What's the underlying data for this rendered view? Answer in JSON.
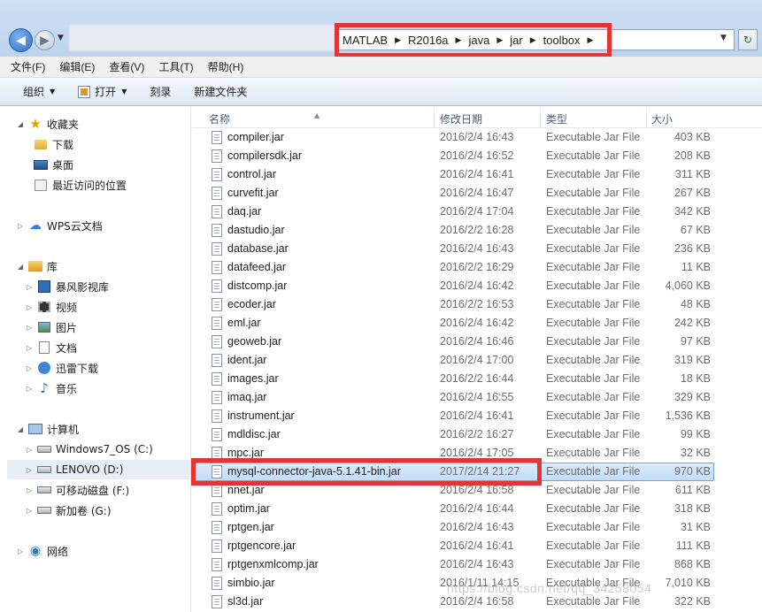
{
  "address": {
    "crumbs": [
      "MATLAB",
      "R2016a",
      "java",
      "jar",
      "toolbox"
    ]
  },
  "menu": [
    "文件(F)",
    "编辑(E)",
    "查看(V)",
    "工具(T)",
    "帮助(H)"
  ],
  "toolbar": {
    "organize": "组织",
    "open": "打开",
    "burn": "刻录",
    "new_folder": "新建文件夹"
  },
  "nav": {
    "favorites": "收藏夹",
    "downloads": "下载",
    "desktop": "桌面",
    "recent": "最近访问的位置",
    "wps": "WPS云文档",
    "libraries": "库",
    "baofeng": "暴风影视库",
    "videos": "视频",
    "pictures": "图片",
    "documents": "文档",
    "xunlei": "迅雷下载",
    "music": "音乐",
    "computer": "计算机",
    "drive_c": "Windows7_OS (C:)",
    "drive_d": "LENOVO (D:)",
    "drive_f": "可移动磁盘 (F:)",
    "drive_g": "新加卷 (G:)",
    "network": "网络"
  },
  "columns": {
    "name": "名称",
    "date": "修改日期",
    "type": "类型",
    "size": "大小"
  },
  "files": [
    {
      "name": "compiler.jar",
      "date": "2016/2/4 16:43",
      "type": "Executable Jar File",
      "size": "403 KB"
    },
    {
      "name": "compilersdk.jar",
      "date": "2016/2/4 16:52",
      "type": "Executable Jar File",
      "size": "208 KB"
    },
    {
      "name": "control.jar",
      "date": "2016/2/4 16:41",
      "type": "Executable Jar File",
      "size": "311 KB"
    },
    {
      "name": "curvefit.jar",
      "date": "2016/2/4 16:47",
      "type": "Executable Jar File",
      "size": "267 KB"
    },
    {
      "name": "daq.jar",
      "date": "2016/2/4 17:04",
      "type": "Executable Jar File",
      "size": "342 KB"
    },
    {
      "name": "dastudio.jar",
      "date": "2016/2/2 16:28",
      "type": "Executable Jar File",
      "size": "67 KB"
    },
    {
      "name": "database.jar",
      "date": "2016/2/4 16:43",
      "type": "Executable Jar File",
      "size": "236 KB"
    },
    {
      "name": "datafeed.jar",
      "date": "2016/2/2 16:29",
      "type": "Executable Jar File",
      "size": "11 KB"
    },
    {
      "name": "distcomp.jar",
      "date": "2016/2/4 16:42",
      "type": "Executable Jar File",
      "size": "4,060 KB"
    },
    {
      "name": "ecoder.jar",
      "date": "2016/2/2 16:53",
      "type": "Executable Jar File",
      "size": "48 KB"
    },
    {
      "name": "eml.jar",
      "date": "2016/2/4 16:42",
      "type": "Executable Jar File",
      "size": "242 KB"
    },
    {
      "name": "geoweb.jar",
      "date": "2016/2/4 16:46",
      "type": "Executable Jar File",
      "size": "97 KB"
    },
    {
      "name": "ident.jar",
      "date": "2016/2/4 17:00",
      "type": "Executable Jar File",
      "size": "319 KB"
    },
    {
      "name": "images.jar",
      "date": "2016/2/2 16:44",
      "type": "Executable Jar File",
      "size": "18 KB"
    },
    {
      "name": "imaq.jar",
      "date": "2016/2/4 16:55",
      "type": "Executable Jar File",
      "size": "329 KB"
    },
    {
      "name": "instrument.jar",
      "date": "2016/2/4 16:41",
      "type": "Executable Jar File",
      "size": "1,536 KB"
    },
    {
      "name": "mdldisc.jar",
      "date": "2016/2/2 16:27",
      "type": "Executable Jar File",
      "size": "99 KB"
    },
    {
      "name": "mpc.jar",
      "date": "2016/2/4 17:05",
      "type": "Executable Jar File",
      "size": "32 KB"
    },
    {
      "name": "mysql-connector-java-5.1.41-bin.jar",
      "date": "2017/2/14 21:27",
      "type": "Executable Jar File",
      "size": "970 KB"
    },
    {
      "name": "nnet.jar",
      "date": "2016/2/4 16:58",
      "type": "Executable Jar File",
      "size": "611 KB"
    },
    {
      "name": "optim.jar",
      "date": "2016/2/4 16:44",
      "type": "Executable Jar File",
      "size": "318 KB"
    },
    {
      "name": "rptgen.jar",
      "date": "2016/2/4 16:43",
      "type": "Executable Jar File",
      "size": "31 KB"
    },
    {
      "name": "rptgencore.jar",
      "date": "2016/2/4 16:41",
      "type": "Executable Jar File",
      "size": "111 KB"
    },
    {
      "name": "rptgenxmlcomp.jar",
      "date": "2016/2/4 16:43",
      "type": "Executable Jar File",
      "size": "868 KB"
    },
    {
      "name": "simbio.jar",
      "date": "2016/1/11 14:15",
      "type": "Executable Jar File",
      "size": "7,010 KB"
    },
    {
      "name": "sl3d.jar",
      "date": "2016/2/4 16:58",
      "type": "Executable Jar File",
      "size": "322 KB"
    }
  ],
  "watermark": "https://blog.csdn.net/qq_34258054",
  "colors": {
    "highlight_red": "#e23636",
    "selection": "#c1dcfc"
  }
}
